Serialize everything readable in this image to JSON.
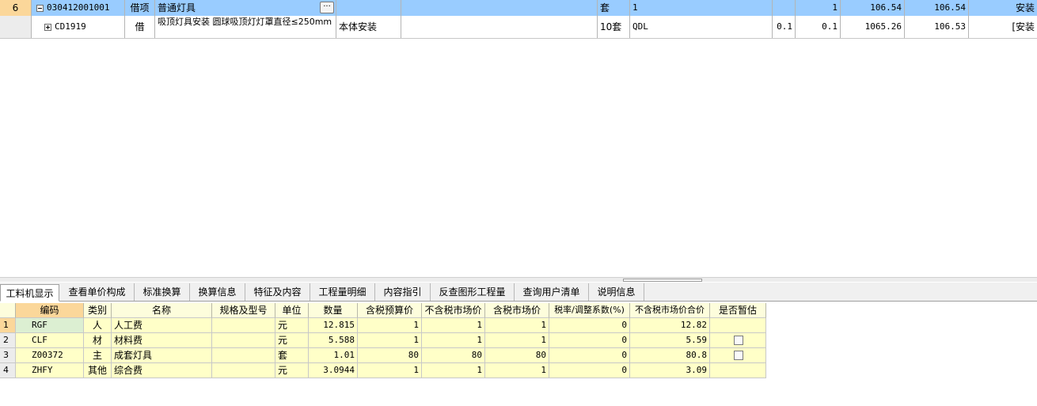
{
  "top_grid": {
    "rows": [
      {
        "rownum": "6",
        "code": "030412001001",
        "type": "借项",
        "name": "普通灯具",
        "more_label": "···",
        "feature": "",
        "spec": "",
        "unit": "套",
        "expr": "1",
        "qty1": "",
        "qty2": "1",
        "price": "106.54",
        "total": "106.54",
        "category": "安装"
      },
      {
        "rownum": "",
        "code": "CD1919",
        "type": "借",
        "name": "吸顶灯具安装 圆球吸顶灯灯罩直径≤250mm",
        "feature": "本体安装",
        "spec": "",
        "unit": "10套",
        "expr": "QDL",
        "qty1": "0.1",
        "qty2": "0.1",
        "price": "1065.26",
        "total": "106.53",
        "category": "[安装"
      }
    ]
  },
  "tabs": [
    {
      "label": "工料机显示",
      "active": true
    },
    {
      "label": "查看单价构成"
    },
    {
      "label": "标准换算"
    },
    {
      "label": "换算信息"
    },
    {
      "label": "特征及内容"
    },
    {
      "label": "工程量明细"
    },
    {
      "label": "内容指引"
    },
    {
      "label": "反查图形工程量"
    },
    {
      "label": "查询用户清单"
    },
    {
      "label": "说明信息"
    }
  ],
  "bottom_grid": {
    "headers": [
      "",
      "编码",
      "类别",
      "名称",
      "规格及型号",
      "单位",
      "数量",
      "含税预算价",
      "不含税市场价",
      "含税市场价",
      "税率/调整系数(%)",
      "不含税市场价合价",
      "是否暂估"
    ],
    "rows": [
      {
        "n": "1",
        "code": "RGF",
        "cat": "人",
        "name": "人工费",
        "spec": "",
        "unit": "元",
        "qty": "12.815",
        "p1": "1",
        "p2": "1",
        "p3": "1",
        "rate": "0",
        "sum": "12.82",
        "est": false
      },
      {
        "n": "2",
        "code": "CLF",
        "cat": "材",
        "name": "材料费",
        "spec": "",
        "unit": "元",
        "qty": "5.588",
        "p1": "1",
        "p2": "1",
        "p3": "1",
        "rate": "0",
        "sum": "5.59",
        "est": true
      },
      {
        "n": "3",
        "code": "Z00372",
        "cat": "主",
        "name": "成套灯具",
        "spec": "",
        "unit": "套",
        "qty": "1.01",
        "p1": "80",
        "p2": "80",
        "p3": "80",
        "rate": "0",
        "sum": "80.8",
        "est": true
      },
      {
        "n": "4",
        "code": "ZHFY",
        "cat": "其他",
        "name": "综合费",
        "spec": "",
        "unit": "元",
        "qty": "3.0944",
        "p1": "1",
        "p2": "1",
        "p3": "1",
        "rate": "0",
        "sum": "3.09",
        "est": false
      }
    ]
  }
}
